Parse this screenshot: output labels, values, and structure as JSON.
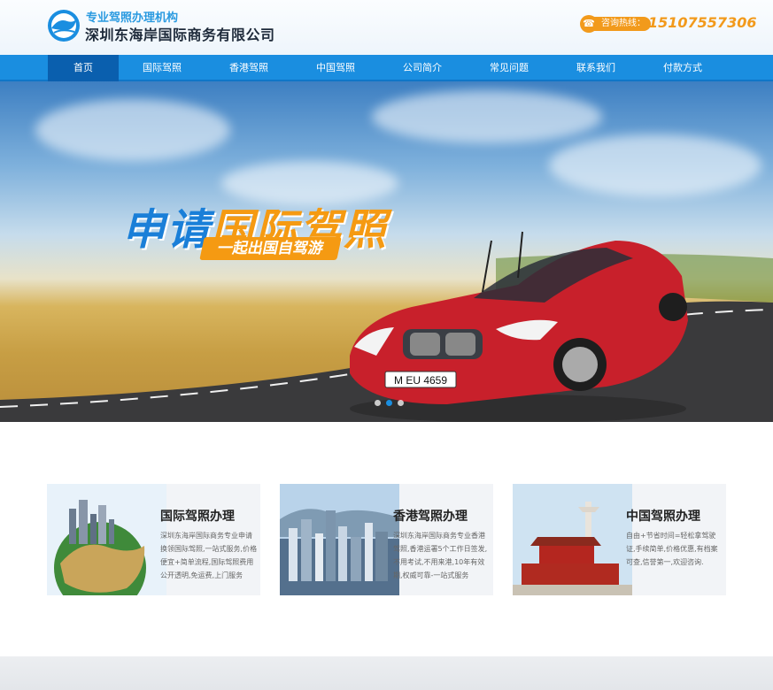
{
  "header": {
    "tagline": "专业驾照办理机构",
    "company_name": "深圳东海岸国际商务有限公司",
    "hotline_label": "咨询热线：",
    "hotline_number": "15107557306",
    "icons": {
      "logo": "wave-logo-icon",
      "phone": "phone-icon"
    }
  },
  "nav": {
    "items": [
      {
        "label": "首页",
        "active": true
      },
      {
        "label": "国际驾照"
      },
      {
        "label": "香港驾照"
      },
      {
        "label": "中国驾照"
      },
      {
        "label": "公司简介"
      },
      {
        "label": "常见问题"
      },
      {
        "label": "联系我们"
      },
      {
        "label": "付款方式"
      }
    ]
  },
  "banner": {
    "headline_blue": "申请",
    "headline_orange": "国际驾照",
    "subline": "一起出国自驾游",
    "plate": "M EU 4659",
    "slide_count": 3,
    "active_slide": 2
  },
  "cards": [
    {
      "title": "国际驾照办理",
      "desc": "深圳东海岸国际商务专业申请换领国际驾照,一站式服务,价格便宜+简单流程,国际驾照费用公开透明,免运费,上门服务",
      "image": "globe-city"
    },
    {
      "title": "香港驾照办理",
      "desc": "深圳东海岸国际商务专业香港驾照,香港运署5个工作日签发,不用考试,不用来港,10年有效期,权威可靠-一站式服务",
      "image": "hong-kong-skyline"
    },
    {
      "title": "中国驾照办理",
      "desc": "自由+节省时间=轻松拿驾驶证,手续简单,价格优惠,有档案可查,信誉第一,欢迎咨询.",
      "image": "tiananmen"
    }
  ],
  "colors": {
    "brand_blue": "#1a8ee0",
    "nav_active": "#0a5fae",
    "accent_orange": "#f29a1b",
    "car_red": "#c8202b"
  }
}
